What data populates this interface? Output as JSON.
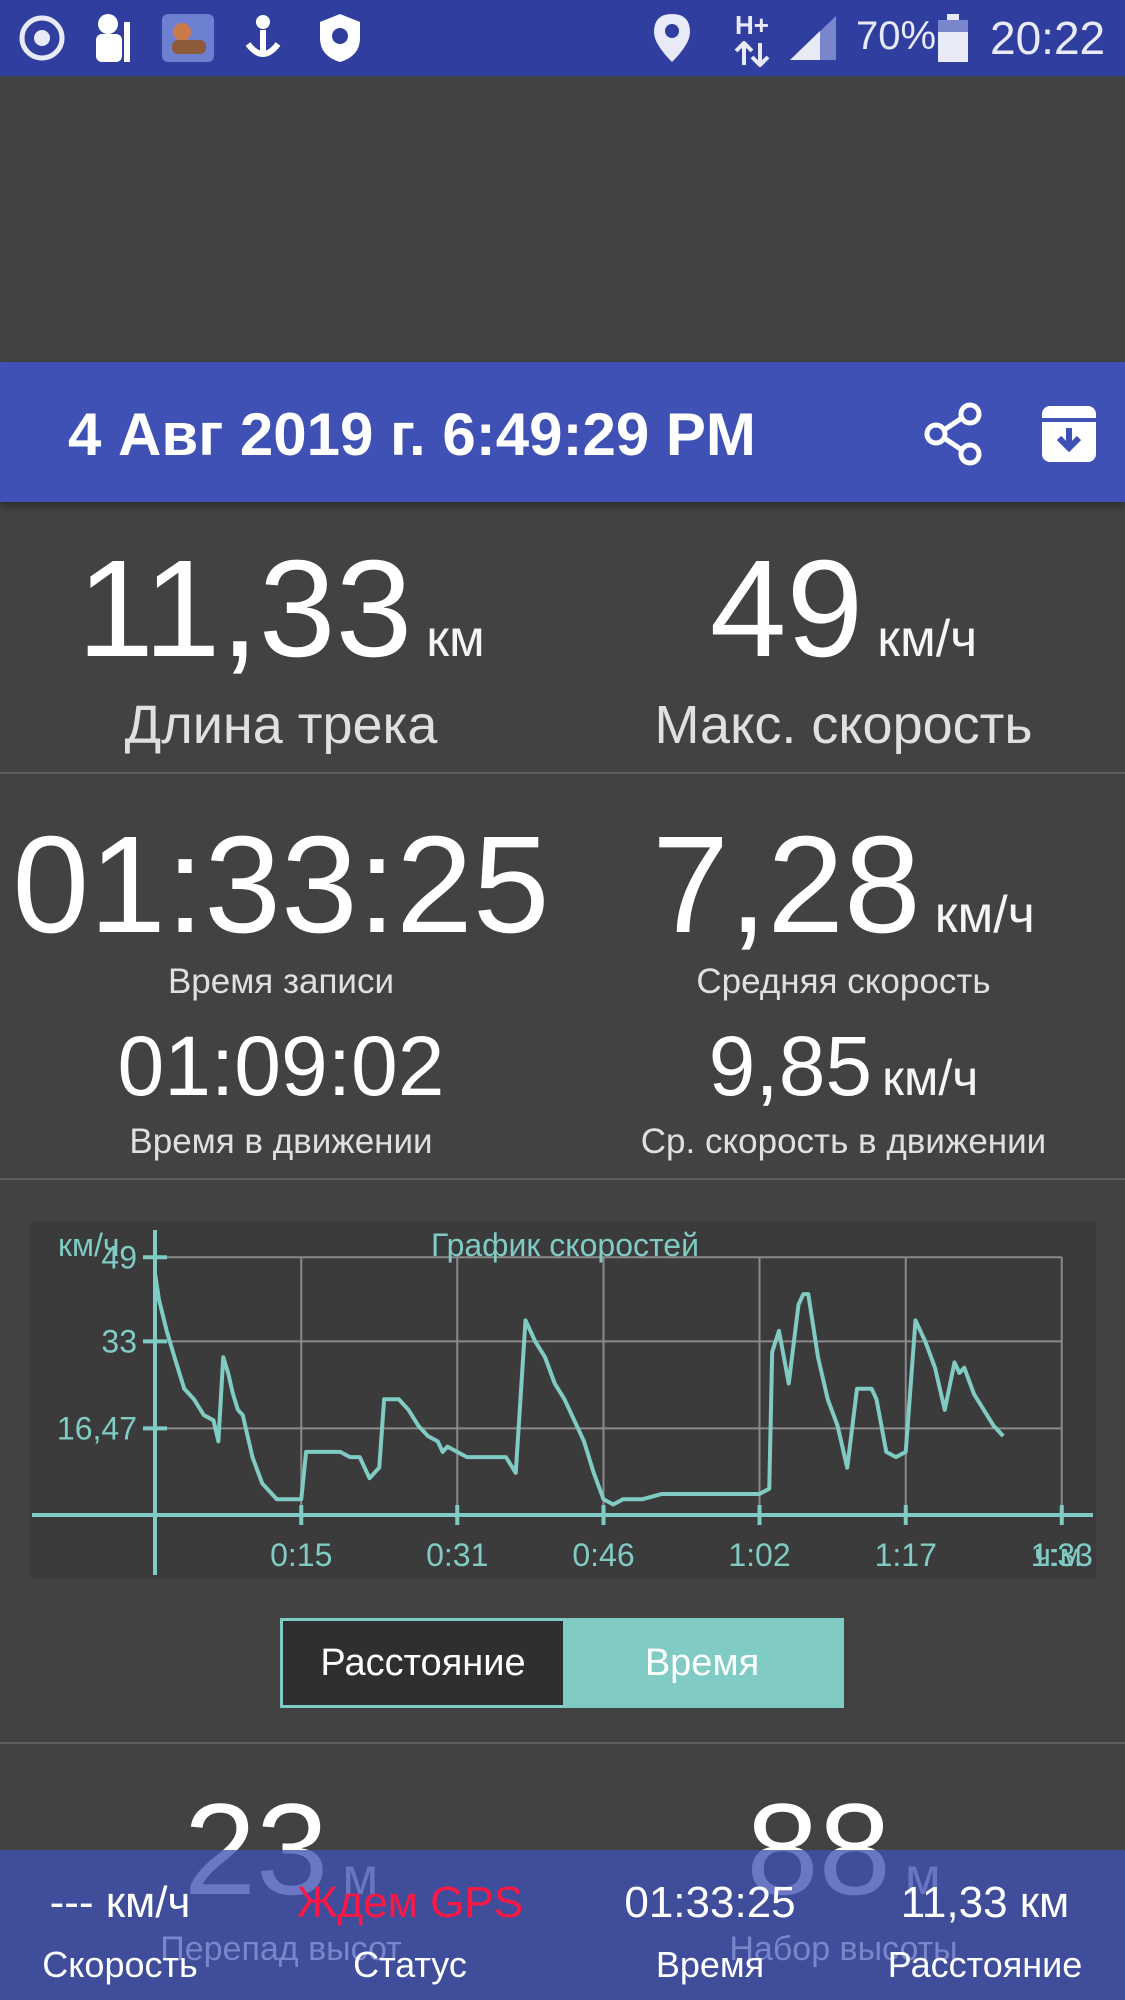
{
  "status_bar": {
    "icons": [
      "target-icon",
      "app-icon-man",
      "app-icon-centaur",
      "app-icon-anchor",
      "app-icon-shield",
      "location-pin-icon",
      "network-hplus-icon",
      "signal-icon",
      "battery-icon"
    ],
    "network": "H+",
    "battery": "70%",
    "clock": "20:22"
  },
  "header": {
    "title": "4 Авг 2019 г. 6:49:29 PM",
    "background": "#3f51b5"
  },
  "stats": {
    "track_length": {
      "value": "11,33",
      "unit": "км",
      "label": "Длина трека"
    },
    "max_speed": {
      "value": "49",
      "unit": "км/ч",
      "label": "Макс. скорость"
    },
    "record_time": {
      "value": "01:33:25",
      "label": "Время записи"
    },
    "avg_speed": {
      "value": "7,28",
      "unit": "км/ч",
      "label": "Средняя скорость"
    },
    "moving_time": {
      "value": "01:09:02",
      "label": "Время в движении"
    },
    "moving_avg_speed": {
      "value": "9,85",
      "unit": "км/ч",
      "label": "Ср. скорость в движении"
    }
  },
  "chart_data": {
    "type": "line",
    "title": "График скоростей",
    "ylabel": "км/ч",
    "xlabel": "ч:м",
    "color": "#80cbc4",
    "y_ticks": [
      "49",
      "33",
      "16,47"
    ],
    "y_tick_values": [
      49,
      33,
      16.47
    ],
    "x_ticks": [
      "0:15",
      "0:31",
      "0:46",
      "1:02",
      "1:17",
      "1:33"
    ],
    "x_tick_values": [
      15,
      31,
      46,
      62,
      77,
      93
    ],
    "xlim": [
      0,
      96
    ],
    "ylim": [
      0,
      50
    ],
    "grid": true,
    "series": [
      {
        "x": [
          0,
          0.4,
          1.2,
          2,
          3,
          4,
          5,
          6,
          6.5,
          7,
          7.5,
          8,
          8.5,
          9,
          10,
          11,
          12,
          12.5,
          13,
          14,
          15,
          15.5,
          16,
          18,
          19,
          20,
          21,
          22,
          23,
          23.5,
          24,
          25,
          26,
          27,
          27.5,
          28,
          29,
          29.5,
          30,
          31,
          32,
          33,
          34,
          35,
          36,
          37,
          38,
          38.5,
          39,
          40,
          41,
          42,
          43,
          44,
          45,
          46,
          47,
          48,
          50,
          52,
          55,
          58,
          61,
          62,
          63,
          63.3,
          64,
          65,
          66,
          66.5,
          67,
          68,
          69,
          70,
          71,
          72,
          73,
          73.5,
          74,
          75,
          76,
          77,
          78,
          79,
          80,
          81,
          82,
          82.5,
          83,
          84,
          85,
          86,
          87
        ],
        "y": [
          46,
          41,
          35,
          30,
          24,
          22,
          19,
          18,
          14,
          30,
          27,
          23,
          20,
          19,
          11,
          6,
          4,
          3,
          3,
          3,
          3,
          12,
          12,
          12,
          12,
          11,
          11,
          7,
          9,
          22,
          22,
          22,
          20,
          17,
          16,
          15,
          14,
          12,
          13,
          12,
          11,
          11,
          11,
          11,
          11,
          8,
          37,
          35,
          33,
          30,
          25,
          22,
          18,
          14,
          8,
          3,
          2,
          3,
          3,
          4,
          4,
          4,
          4,
          4,
          5,
          31,
          35,
          25,
          40,
          42,
          42,
          30,
          22,
          17,
          9,
          24,
          24,
          24,
          22,
          12,
          11,
          12,
          37,
          33,
          28,
          20,
          29,
          27,
          28,
          23,
          20,
          17,
          15
        ]
      }
    ]
  },
  "toggle": {
    "left_label": "Расстояние",
    "right_label": "Время",
    "active": "right"
  },
  "bottom_stats": {
    "elevation_diff": {
      "value": "23",
      "unit": "м",
      "label": "Перепад высот"
    },
    "elevation_gain": {
      "value": "88",
      "unit": "м",
      "label": "Набор высоты"
    }
  },
  "bottom_bar": {
    "speed_value": "--- км/ч",
    "speed_label": "Скорость",
    "status_value": "Ждем GPS",
    "status_label": "Статус",
    "status_color": "#ff1744",
    "time_value": "01:33:25",
    "time_label": "Время",
    "distance_value": "11,33 км",
    "distance_label": "Расстояние"
  }
}
